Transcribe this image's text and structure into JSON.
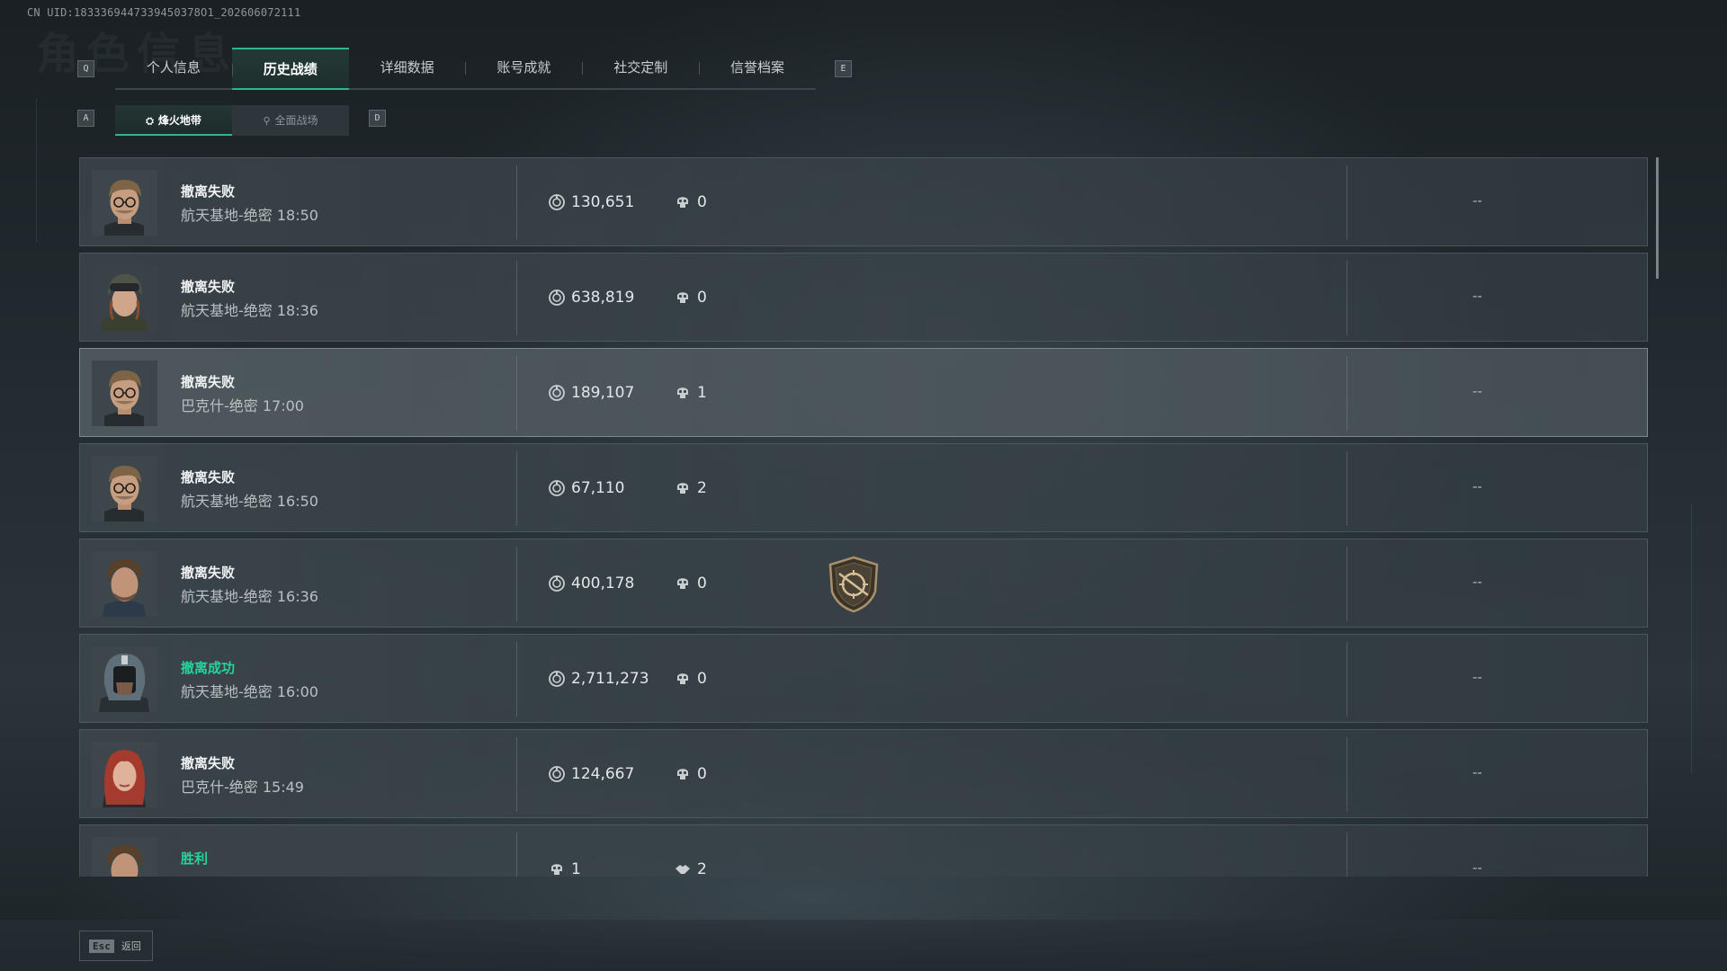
{
  "uid": "CN UID:1833369447339450378O1_202606072111",
  "page_title_bg": "角色信息",
  "keys": {
    "left_tab": "Q",
    "right_tab": "E",
    "left_sub": "A",
    "right_sub": "D"
  },
  "tabs": [
    {
      "label": "个人信息",
      "active": false
    },
    {
      "label": "历史战绩",
      "active": true
    },
    {
      "label": "详细数据",
      "active": false
    },
    {
      "label": "账号成就",
      "active": false
    },
    {
      "label": "社交定制",
      "active": false
    },
    {
      "label": "信誉档案",
      "active": false
    }
  ],
  "subtabs": [
    {
      "label": "烽火地带",
      "icon": "flame-zone-icon",
      "active": true
    },
    {
      "label": "全面战场",
      "icon": "battlefield-icon",
      "active": false
    }
  ],
  "records": [
    {
      "status": "撤离失败",
      "map": "航天基地-绝密 18:50",
      "value": "130,651",
      "kills": "0",
      "extra": "--",
      "success": false,
      "avatar": "operator-glasses"
    },
    {
      "status": "撤离失败",
      "map": "航天基地-绝密 18:36",
      "value": "638,819",
      "kills": "0",
      "extra": "--",
      "success": false,
      "avatar": "operator-goggles"
    },
    {
      "status": "撤离失败",
      "map": "巴克什-绝密 17:00",
      "value": "189,107",
      "kills": "1",
      "extra": "--",
      "success": false,
      "avatar": "operator-glasses"
    },
    {
      "status": "撤离失败",
      "map": "航天基地-绝密 16:50",
      "value": "67,110",
      "kills": "2",
      "extra": "--",
      "success": false,
      "avatar": "operator-glasses"
    },
    {
      "status": "撤离失败",
      "map": "航天基地-绝密 16:36",
      "value": "400,178",
      "kills": "0",
      "extra": "--",
      "success": false,
      "avatar": "operator-brown-hair",
      "badge": "crosshair-shield-badge"
    },
    {
      "status": "撤离成功",
      "map": "航天基地-绝密 16:00",
      "value": "2,711,273",
      "kills": "0",
      "extra": "--",
      "success": true,
      "avatar": "operator-helmet-mask"
    },
    {
      "status": "撤离失败",
      "map": "巴克什-绝密 15:49",
      "value": "124,667",
      "kills": "0",
      "extra": "--",
      "success": false,
      "avatar": "operator-red-hair"
    },
    {
      "status": "胜利",
      "map": "",
      "kills": "1",
      "assists": "2",
      "extra": "--",
      "success": true,
      "avatar": "operator-brown-hair"
    }
  ],
  "footer": {
    "esc_key": "Esc",
    "back_label": "返回"
  },
  "colors": {
    "accent": "#2fb68c",
    "success": "#25d39b"
  }
}
